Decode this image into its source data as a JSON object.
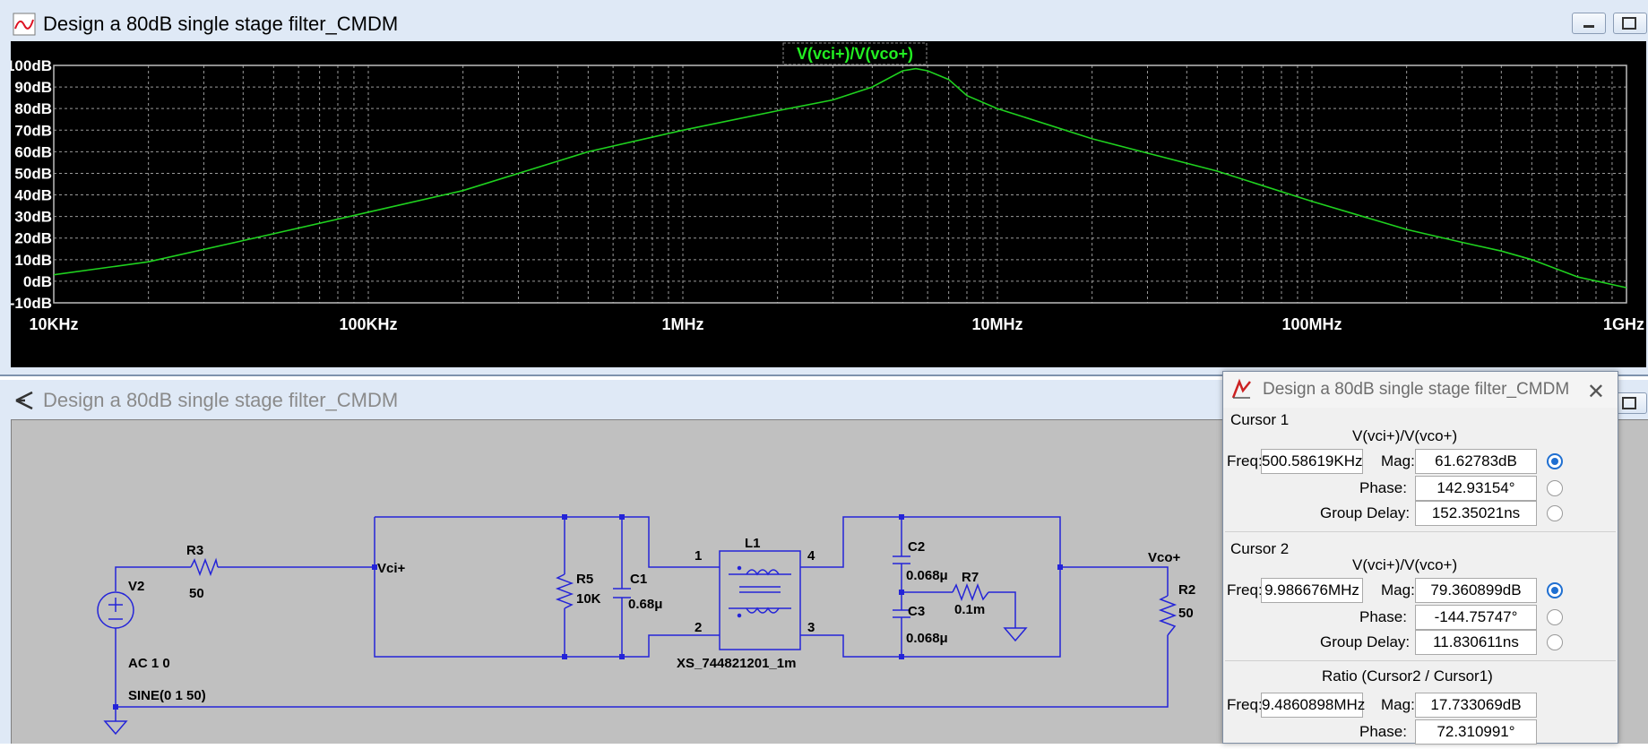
{
  "plot_window": {
    "title": "Design a 80dB single stage filter_CMDM",
    "trace_label": "V(vci+)/V(vco+)",
    "colors": {
      "background": "#000000",
      "trace": "#1fd11f",
      "grid": "#9a9a9a",
      "text": "#ffffff",
      "label": "#22ee22"
    },
    "y_ticks": [
      "100dB",
      "90dB",
      "80dB",
      "70dB",
      "60dB",
      "50dB",
      "40dB",
      "30dB",
      "20dB",
      "10dB",
      "0dB",
      "-10dB"
    ],
    "x_ticks": [
      "10KHz",
      "100KHz",
      "1MHz",
      "10MHz",
      "100MHz",
      "1GHz"
    ]
  },
  "chart_data": {
    "type": "line",
    "title": "V(vci+)/V(vco+)",
    "x_scale": "log",
    "xlim": [
      10000,
      1000000000
    ],
    "ylim": [
      -10,
      100
    ],
    "grid": true,
    "series": [
      {
        "name": "V(vci+)/V(vco+)",
        "x": [
          10000,
          20000,
          50000,
          100000,
          200000,
          500000,
          1000000,
          2000000,
          3000000,
          4000000,
          5000000,
          5500000,
          6000000,
          7000000,
          8000000,
          10000000,
          20000000,
          50000000,
          100000000,
          200000000,
          300000000,
          400000000,
          500000000,
          700000000,
          1000000000
        ],
        "y": [
          3,
          9,
          22,
          32,
          42,
          60,
          70,
          79,
          84,
          90,
          97.5,
          98.5,
          97.5,
          93.5,
          86,
          80,
          66,
          51,
          37,
          24,
          18,
          14,
          10,
          2,
          -3
        ]
      }
    ]
  },
  "schematic_window": {
    "title": "Design a 80dB single stage filter_CMDM",
    "labels": {
      "v2": "V2",
      "v2_ac": "AC 1 0",
      "v2_sine": "SINE(0 1 50)",
      "r3": "R3",
      "r3_val": "50",
      "vci": "Vci+",
      "r5": "R5",
      "r5_val": "10K",
      "c1": "C1",
      "c1_val": "0.68μ",
      "l1": "L1",
      "pin1": "1",
      "pin2": "2",
      "pin3": "3",
      "pin4": "4",
      "xs": "XS_744821201_1m",
      "c2": "C2",
      "c2_val": "0.068μ",
      "c3": "C3",
      "c3_val": "0.068μ",
      "r7": "R7",
      "r7_val": "0.1m",
      "vco": "Vco+",
      "r2": "R2",
      "r2_val": "50"
    },
    "colors": {
      "background": "#c0c0c0",
      "wire": "#2424d8",
      "text": "#000000"
    }
  },
  "cursor_window": {
    "title": "Design a 80dB single stage filter_CMDM",
    "close": "✕",
    "cursor1": {
      "heading": "Cursor 1",
      "trace": "V(vci+)/V(vco+)",
      "freq_label": "Freq:",
      "freq": "500.58619KHz",
      "mag_label": "Mag:",
      "mag": "61.62783dB",
      "phase_label": "Phase:",
      "phase": "142.93154°",
      "gd_label": "Group Delay:",
      "gd": "152.35021ns"
    },
    "cursor2": {
      "heading": "Cursor 2",
      "trace": "V(vci+)/V(vco+)",
      "freq_label": "Freq:",
      "freq": "9.986676MHz",
      "mag_label": "Mag:",
      "mag": "79.360899dB",
      "phase_label": "Phase:",
      "phase": "-144.75747°",
      "gd_label": "Group Delay:",
      "gd": "11.830611ns"
    },
    "ratio": {
      "heading": "Ratio (Cursor2 / Cursor1)",
      "freq_label": "Freq:",
      "freq": "9.4860898MHz",
      "mag_label": "Mag:",
      "mag": "17.733069dB",
      "phase_label": "Phase:",
      "phase": "72.310991°"
    }
  }
}
